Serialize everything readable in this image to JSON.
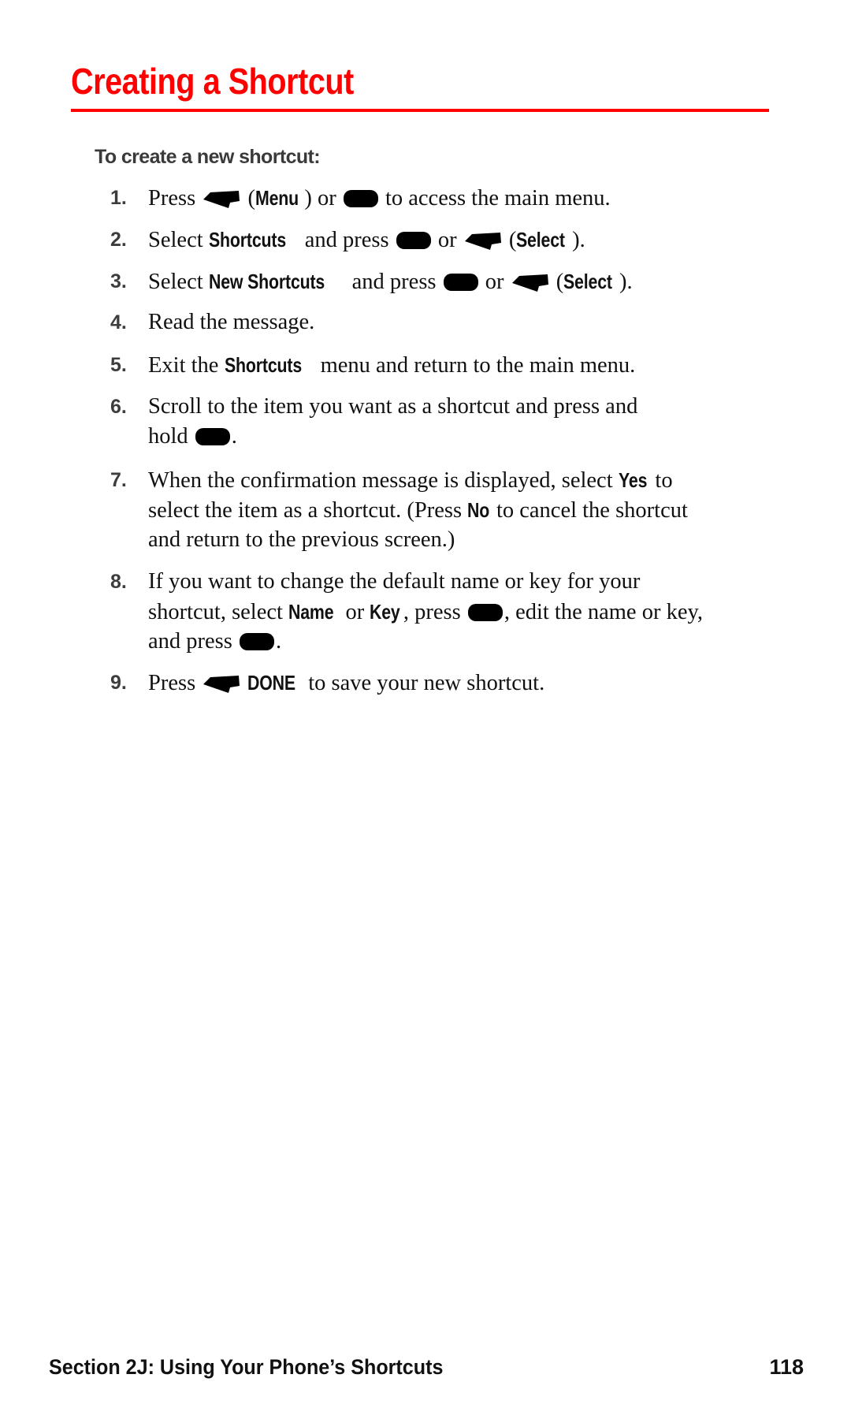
{
  "page": {
    "title": "Creating a Shortcut",
    "accent_color": "#ff0000",
    "subheading": "To create a new shortcut:"
  },
  "icons": {
    "softkey": "left-softkey-icon",
    "menu_ok": "menu-ok-key-icon"
  },
  "steps": [
    {
      "number": "1.",
      "parts": {
        "a": "Press ",
        "b": "(",
        "c": "Menu",
        "d": ") or ",
        "e": " to access the main menu."
      }
    },
    {
      "number": "2.",
      "parts": {
        "a": "Select ",
        "b": "Shortcuts",
        "c": " and press ",
        "d": " or ",
        "e": " (",
        "f": "Select",
        "g": ")."
      }
    },
    {
      "number": "3.",
      "parts": {
        "a": "Select ",
        "b": "New Shortcuts",
        "c": " and press ",
        "d": " or ",
        "e": " (",
        "f": "Select",
        "g": ")."
      }
    },
    {
      "number": "4.",
      "parts": {
        "a": "Read the message."
      }
    },
    {
      "number": "5.",
      "parts": {
        "a": "Exit the ",
        "b": "Shortcuts",
        "c": " menu and return to the main menu."
      }
    },
    {
      "number": "6.",
      "parts": {
        "a": "Scroll to the item you want as a shortcut and press and",
        "b": "hold ",
        "c": "."
      }
    },
    {
      "number": "7.",
      "parts": {
        "a": "When the confirmation message is displayed, select ",
        "b": "Yes",
        "c": " to",
        "d": "select the item as a shortcut. (Press ",
        "e": "No",
        "f": " to cancel the shortcut",
        "g": "and return to the previous screen.)"
      }
    },
    {
      "number": "8.",
      "parts": {
        "a": "If you want to change the default name or key for your",
        "b": "shortcut, select ",
        "c": "Name",
        "d": " or ",
        "e": "Key",
        "f": ", press ",
        "g": ", edit the name or key,",
        "h": "and press ",
        "i": "."
      }
    },
    {
      "number": "9.",
      "parts": {
        "a": "Press ",
        "b": "DONE",
        "c": " to save your new shortcut."
      }
    }
  ],
  "footer": {
    "section": "Section 2J: Using Your Phone’s Shortcuts",
    "page_number": "118"
  }
}
